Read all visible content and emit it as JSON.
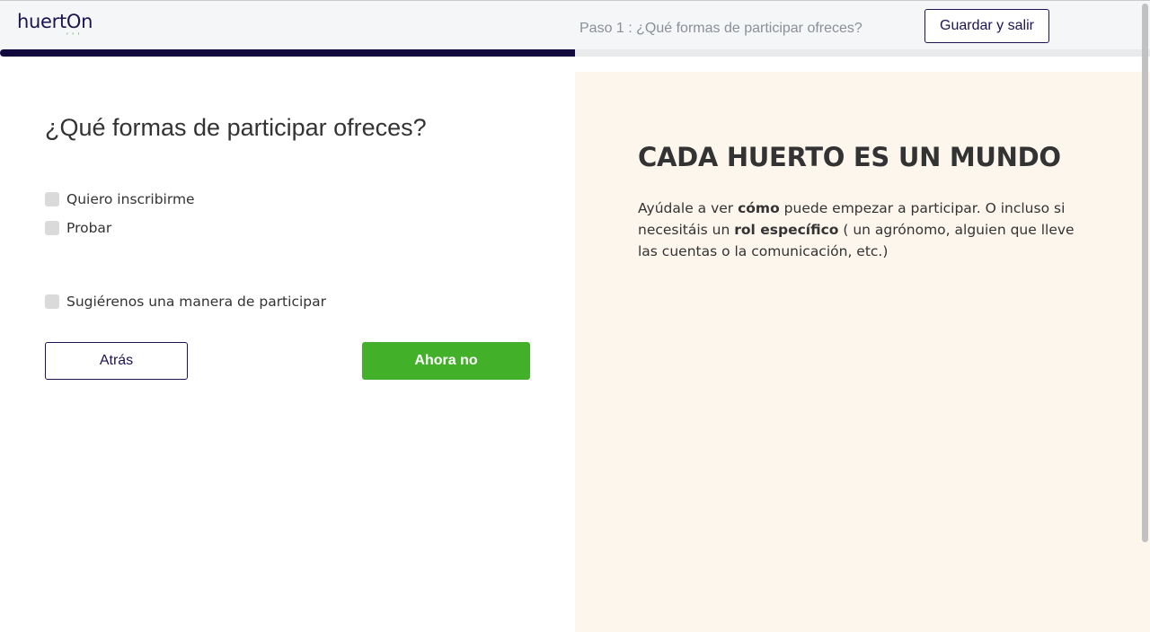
{
  "header": {
    "logo_text": "huertOn",
    "logo_dots": "' ' '",
    "step_label": "Paso 1 : ¿Qué formas de participar ofreces?",
    "save_button_label": "Guardar y salir",
    "progress_fraction": 0.5,
    "accent_color": "#12093f"
  },
  "form": {
    "question": "¿Qué formas de participar ofreces?",
    "options": [
      {
        "label": "Quiero inscribirme",
        "checked": false
      },
      {
        "label": "Probar",
        "checked": false
      },
      {
        "label": "Sugiérenos una manera de participar",
        "checked": false
      }
    ],
    "back_button_label": "Atrás",
    "skip_button_label": "Ahora no",
    "skip_button_color": "#43b02a"
  },
  "tip": {
    "title": "CADA HUERTO ES UN MUNDO",
    "body_part1": "Ayúdale a ver ",
    "body_bold1": "cómo",
    "body_part2": " puede empezar a participar. O incluso si necesitáis un ",
    "body_bold2": "rol específico",
    "body_part3": " ( un agrónomo, alguien que lleve las cuentas o la comunicación, etc.)",
    "background_color": "#fdf6ed"
  }
}
